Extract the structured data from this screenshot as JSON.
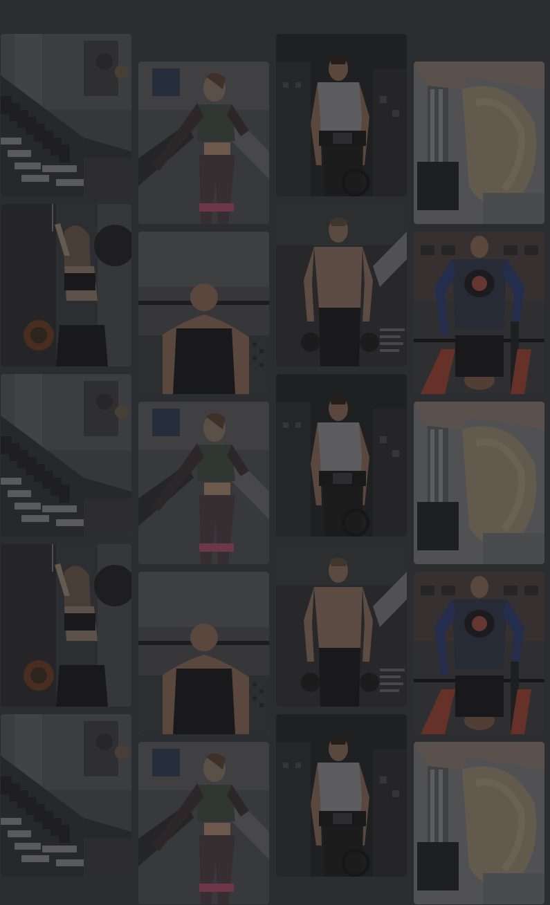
{
  "gallery": {
    "columns": [
      {
        "name": "column-1",
        "tiles": [
          {
            "photo": "dumbbell-rack"
          },
          {
            "photo": "woman-cable-pulldown"
          },
          {
            "photo": "dumbbell-rack"
          },
          {
            "photo": "woman-cable-pulldown"
          },
          {
            "photo": "dumbbell-rack"
          }
        ]
      },
      {
        "name": "column-2",
        "tiles": [
          {
            "photo": "woman-resistance-band"
          },
          {
            "photo": "man-bench-press"
          },
          {
            "photo": "woman-resistance-band"
          },
          {
            "photo": "man-bench-press"
          },
          {
            "photo": "woman-resistance-band"
          }
        ]
      },
      {
        "name": "column-3",
        "tiles": [
          {
            "photo": "man-lifting-belt"
          },
          {
            "photo": "shirtless-man-kettlebells"
          },
          {
            "photo": "man-lifting-belt"
          },
          {
            "photo": "shirtless-man-kettlebells"
          },
          {
            "photo": "man-lifting-belt"
          }
        ]
      },
      {
        "name": "column-4",
        "tiles": [
          {
            "photo": "hand-gripping-dumbbell"
          },
          {
            "photo": "man-spotting-bench"
          },
          {
            "photo": "hand-gripping-dumbbell"
          },
          {
            "photo": "man-spotting-bench"
          },
          {
            "photo": "hand-gripping-dumbbell"
          }
        ]
      }
    ]
  },
  "colors": {
    "background": "#2c2d30",
    "dim_overlay": "#1e1f22"
  }
}
